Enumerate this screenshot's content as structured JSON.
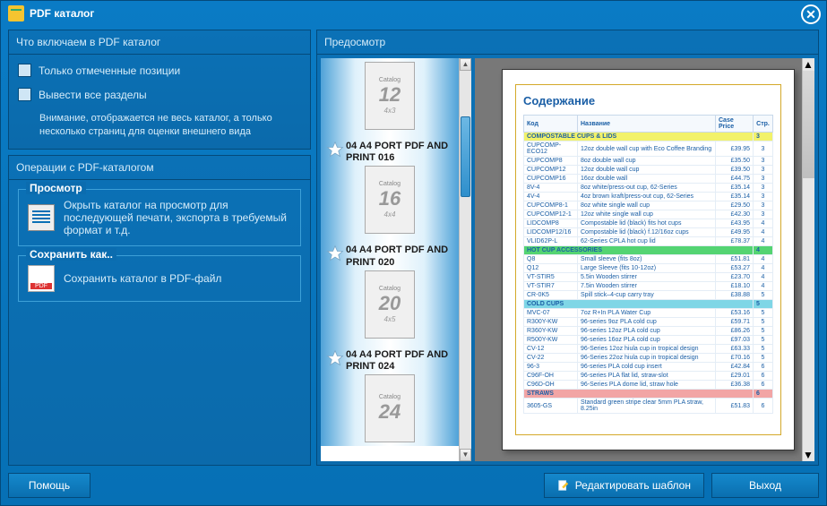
{
  "title": "PDF  каталог",
  "left": {
    "include_header": "Что включаем в PDF каталог",
    "chk_only_marked": "Только отмеченные позиции",
    "chk_all_sections": "Вывести все разделы",
    "hint": "Внимание, отображается не весь каталог, а только несколько страниц для оценки внешнего вида",
    "ops_header": "Операции с PDF-каталогом",
    "preview_title": "Просмотр",
    "preview_text": "Окрыть каталог на просмотр для последующей печати, экспорта в требуемый формат и т.д.",
    "save_title": "Сохранить как..",
    "save_text": "Сохранить каталог в PDF-файл"
  },
  "preview_header": "Предосмотр",
  "thumbs": [
    {
      "num": "12",
      "sub": "4x3",
      "title": ""
    },
    {
      "num": "16",
      "sub": "4x4",
      "title": "04 A4 PORT PDF AND PRINT 016"
    },
    {
      "num": "20",
      "sub": "4x5",
      "title": "04 A4 PORT PDF AND PRINT 020"
    },
    {
      "num": "24",
      "sub": "",
      "title": "04 A4 PORT PDF AND PRINT 024"
    }
  ],
  "thumb_label": "Catalog",
  "toc": {
    "title": "Содержание",
    "cols": [
      "Код",
      "Название",
      "Case Price",
      "Стр."
    ],
    "rows": [
      {
        "sec": "yellow",
        "name": "COMPOSTABLE CUPS & LIDS",
        "page": "3"
      },
      {
        "code": "CUPCOMP-ECO12",
        "name": "12oz double wall cup with Eco Coffee Branding",
        "price": "£39.95",
        "page": "3"
      },
      {
        "code": "CUPCOMP8",
        "name": "8oz double wall cup",
        "price": "£35.50",
        "page": "3"
      },
      {
        "code": "CUPCOMP12",
        "name": "12oz double wall cup",
        "price": "£39.50",
        "page": "3"
      },
      {
        "code": "CUPCOMP16",
        "name": "16oz double wall",
        "price": "£44.75",
        "page": "3"
      },
      {
        "code": "8V-4",
        "name": "8oz white/press-out cup, 62-Series",
        "price": "£35.14",
        "page": "3"
      },
      {
        "code": "4V-4",
        "name": "4oz brown kraft/press-out cup, 62-Series",
        "price": "£35.14",
        "page": "3"
      },
      {
        "code": "CUPCOMP8-1",
        "name": "8oz white single wall cup",
        "price": "£29.50",
        "page": "3"
      },
      {
        "code": "CUPCOMP12-1",
        "name": "12oz white single wall cup",
        "price": "£42.30",
        "page": "3"
      },
      {
        "code": "LIDCOMP8",
        "name": "Compostable lid (black) fits hot cups",
        "price": "£43.95",
        "page": "4"
      },
      {
        "code": "LIDCOMP12/16",
        "name": "Compostable lid (black) f.12/16oz cups",
        "price": "£49.95",
        "page": "4"
      },
      {
        "code": "VLID62P-L",
        "name": "62-Series CPLA hot cup lid",
        "price": "£78.37",
        "page": "4"
      },
      {
        "sec": "green",
        "name": "HOT CUP ACCESSORIES",
        "page": "4"
      },
      {
        "code": "Q8",
        "name": "Small sleeve (fits 8oz)",
        "price": "£51.81",
        "page": "4"
      },
      {
        "code": "Q12",
        "name": "Large Sleeve (fits 10-12oz)",
        "price": "£53.27",
        "page": "4"
      },
      {
        "code": "VT-STIR5",
        "name": "5.5in Wooden stirrer",
        "price": "£23.70",
        "page": "4"
      },
      {
        "code": "VT-STIR7",
        "name": "7.5in Wooden stirrer",
        "price": "£18.10",
        "page": "4"
      },
      {
        "code": "CR-0K5",
        "name": "Spill stick–4-cup carry tray",
        "price": "£38.88",
        "page": "5"
      },
      {
        "sec": "cyan",
        "name": "COLD CUPS",
        "page": "5"
      },
      {
        "code": "MVC-07",
        "name": "7oz R+In PLA Water Cup",
        "price": "£53.16",
        "page": "5"
      },
      {
        "code": "R300Y-KW",
        "name": "96-series 9oz PLA cold cup",
        "price": "£59.71",
        "page": "5"
      },
      {
        "code": "R360Y-KW",
        "name": "96-series 12oz PLA cold cup",
        "price": "£86.26",
        "page": "5"
      },
      {
        "code": "R500Y-KW",
        "name": "96-series 16oz PLA cold cup",
        "price": "£97.03",
        "page": "5"
      },
      {
        "code": "CV-12",
        "name": "96-Series 12oz hiula cup in tropical design",
        "price": "£63.33",
        "page": "5"
      },
      {
        "code": "CV-22",
        "name": "96-Series 22oz hiula cup in tropical design",
        "price": "£70.16",
        "page": "5"
      },
      {
        "code": "96-3",
        "name": "96-series PLA cold cup insert",
        "price": "£42.84",
        "page": "6"
      },
      {
        "code": "C96F-OH",
        "name": "96-series PLA flat lid, straw-slot",
        "price": "£29.01",
        "page": "6"
      },
      {
        "code": "C96D-OH",
        "name": "96-Series PLA dome lid, straw hole",
        "price": "£36.38",
        "page": "6"
      },
      {
        "sec": "pink",
        "name": "STRAWS",
        "page": "6"
      },
      {
        "code": "3605-GS",
        "name": "Standard green stripe clear 5mm PLA straw, 8.25in",
        "price": "£51.83",
        "page": "6"
      }
    ]
  },
  "footer": {
    "help": "Помощь",
    "edit": "Редактировать шаблон",
    "exit": "Выход"
  }
}
